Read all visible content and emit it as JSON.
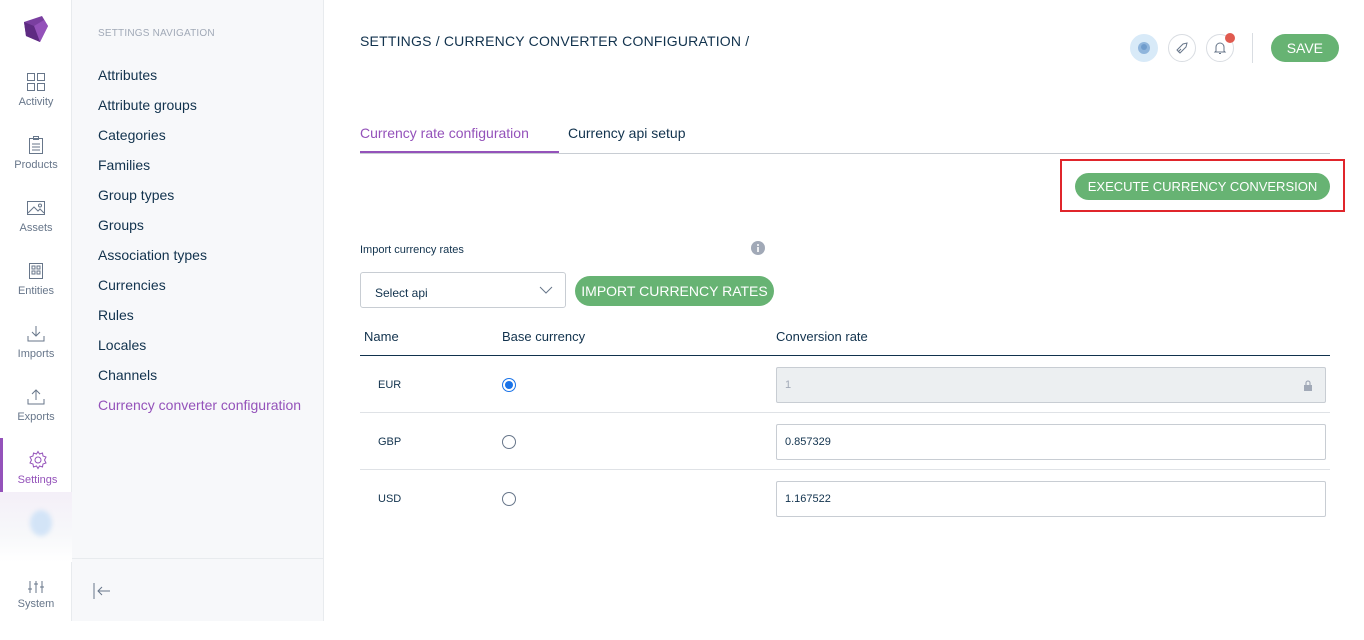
{
  "menu": {
    "items": [
      {
        "label": "Activity",
        "icon": "grid-icon"
      },
      {
        "label": "Products",
        "icon": "clipboard-icon"
      },
      {
        "label": "Assets",
        "icon": "image-icon"
      },
      {
        "label": "Entities",
        "icon": "entities-icon"
      },
      {
        "label": "Imports",
        "icon": "import-icon"
      },
      {
        "label": "Exports",
        "icon": "export-icon"
      },
      {
        "label": "Settings",
        "icon": "gear-icon"
      },
      {
        "label": "System",
        "icon": "sliders-icon"
      }
    ]
  },
  "nav": {
    "title": "SETTINGS NAVIGATION",
    "links": [
      "Attributes",
      "Attribute groups",
      "Categories",
      "Families",
      "Group types",
      "Groups",
      "Association types",
      "Currencies",
      "Rules",
      "Locales",
      "Channels",
      "Currency converter configuration"
    ]
  },
  "header": {
    "breadcrumb": "SETTINGS / CURRENCY CONVERTER CONFIGURATION /",
    "save_label": "SAVE"
  },
  "tabs": {
    "active": "Currency rate configuration",
    "second": "Currency api setup"
  },
  "execute_label": "EXECUTE CURRENCY CONVERSION",
  "import": {
    "label": "Import currency rates",
    "select_placeholder": "Select api",
    "button_label": "IMPORT CURRENCY RATES"
  },
  "grid": {
    "headers": {
      "name": "Name",
      "base": "Base currency",
      "rate": "Conversion rate"
    },
    "rows": [
      {
        "name": "EUR",
        "base": true,
        "rate": "1",
        "locked": true
      },
      {
        "name": "GBP",
        "base": false,
        "rate": "0.857329",
        "locked": false
      },
      {
        "name": "USD",
        "base": false,
        "rate": "1.167522",
        "locked": false
      }
    ]
  },
  "colors": {
    "accent": "#9452ba",
    "green": "#67b373",
    "highlight": "#e0252b"
  }
}
